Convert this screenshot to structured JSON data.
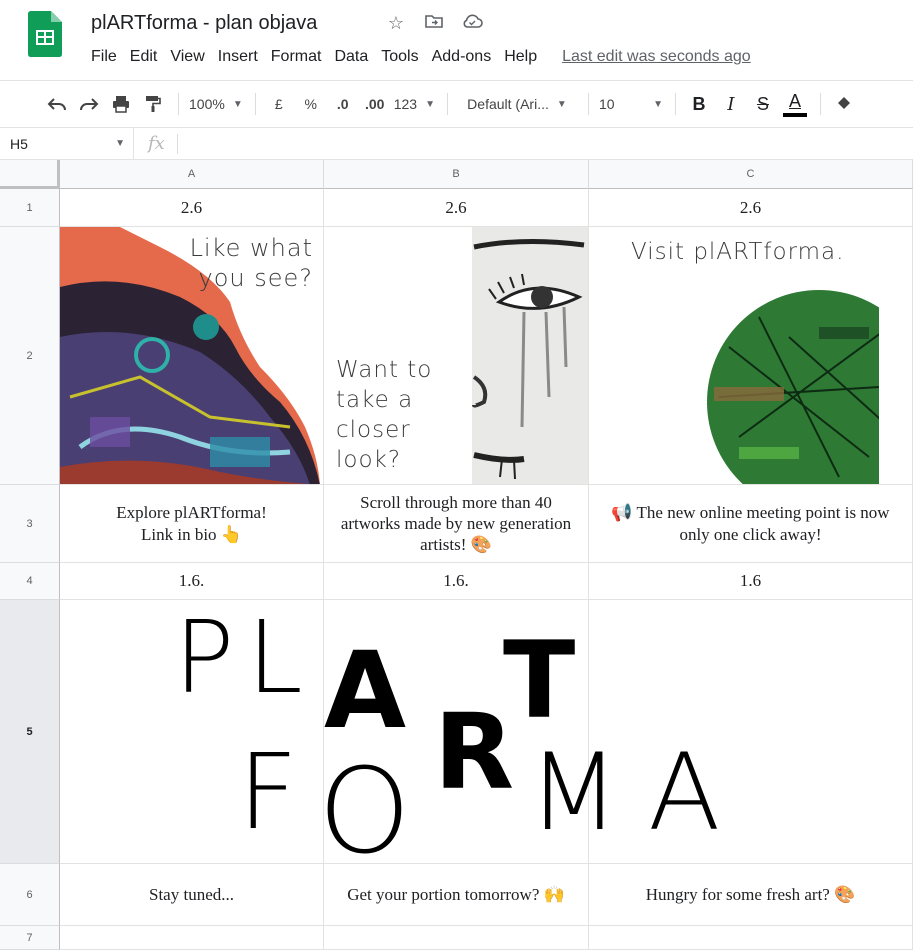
{
  "app": {
    "title": "plARTforma - plan objava",
    "menu": [
      "File",
      "Edit",
      "View",
      "Insert",
      "Format",
      "Data",
      "Tools",
      "Add-ons",
      "Help"
    ],
    "last_edit": "Last edit was seconds ago",
    "accent": "#0f9d58"
  },
  "toolbar": {
    "zoom": "100%",
    "currency": "£",
    "percent": "%",
    "decrease_decimal": ".0",
    "increase_decimal": ".00",
    "number_format": "123",
    "font": "Default (Ari...",
    "font_size": "10",
    "bold": "B",
    "italic": "I",
    "strike": "S",
    "text_color": "A"
  },
  "formula_bar": {
    "cell_ref": "H5",
    "fx": "fx"
  },
  "sheet": {
    "columns": [
      "A",
      "B",
      "C"
    ],
    "rows": [
      "1",
      "2",
      "3",
      "4",
      "5",
      "6",
      "7"
    ],
    "row1": [
      "2.6",
      "2.6",
      "2.6"
    ],
    "row3": [
      "Explore plARTforma!\nLink in bio 👆",
      "Scroll through more than 40 artworks made by new generation artists! 🎨",
      "📢 The new online meeting point is now only one click away!"
    ],
    "row4": [
      "1.6.",
      "1.6.",
      "1.6"
    ],
    "row6": [
      "Stay tuned...",
      "Get your portion tomorrow? 🙌",
      "Hungry for some fresh art? 🎨"
    ],
    "images": {
      "a2_text": [
        "Like what",
        "you see?"
      ],
      "b2_text": [
        "Want to",
        "take a",
        "closer",
        "look?"
      ],
      "c2_text": "Visit plARTforma."
    },
    "logo_letters": [
      "P",
      "L",
      "A",
      "T",
      "F",
      "O",
      "R",
      "M",
      "A"
    ]
  }
}
